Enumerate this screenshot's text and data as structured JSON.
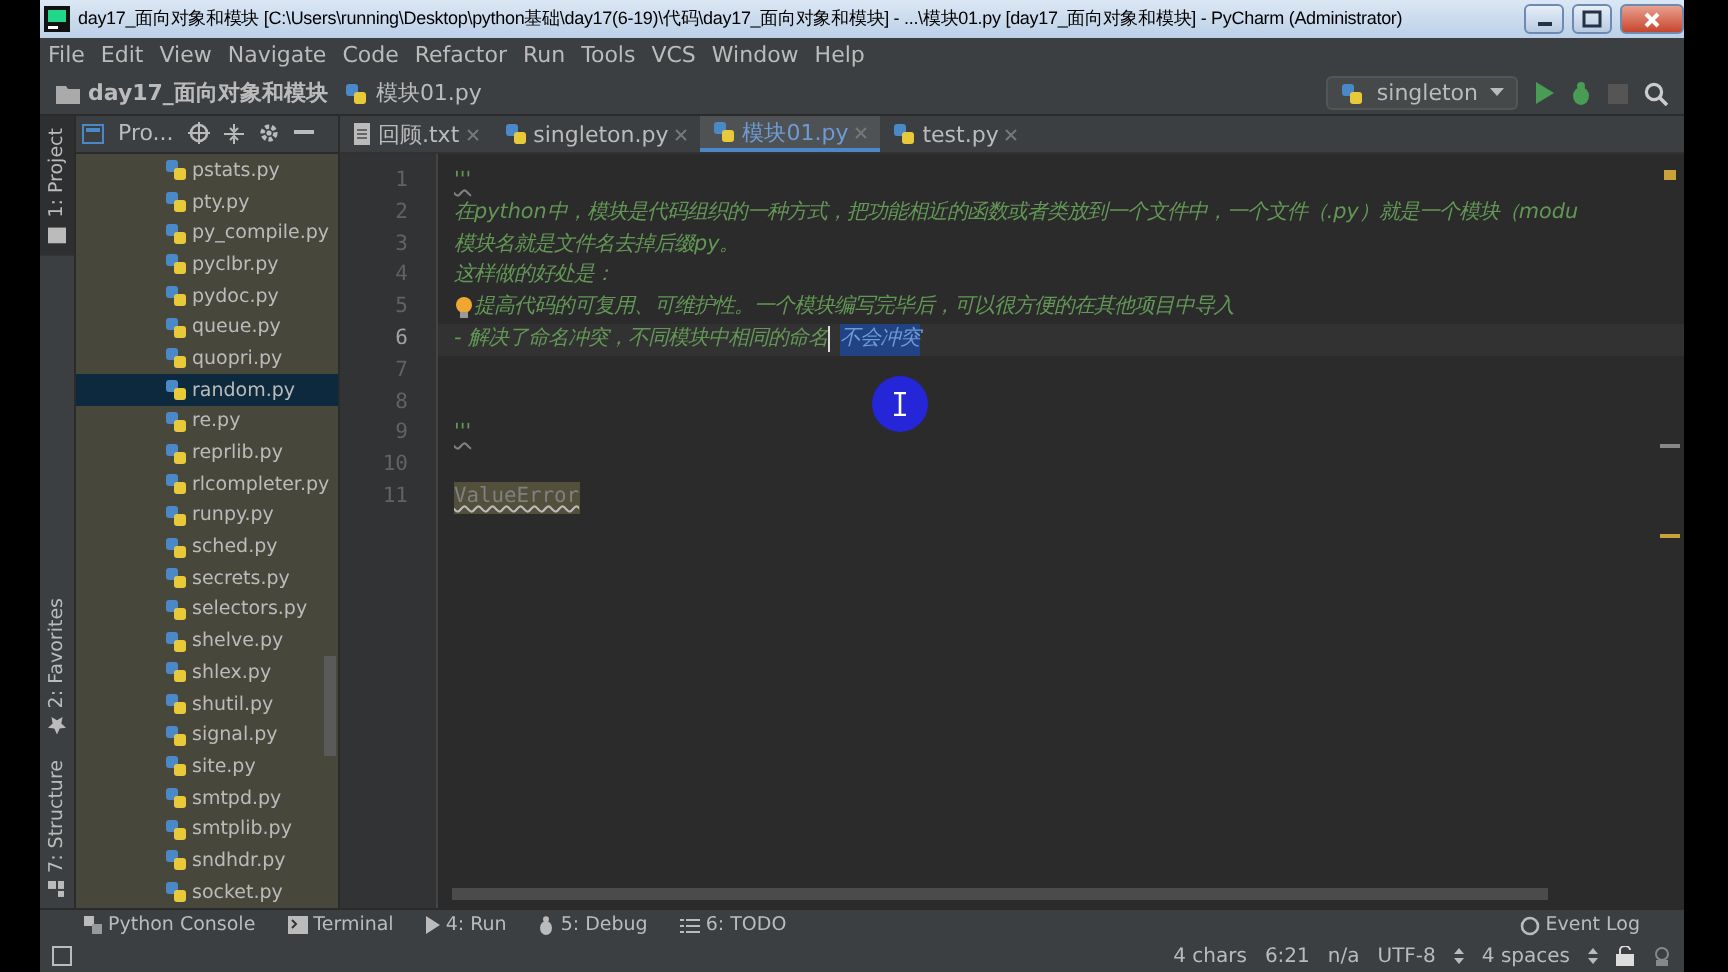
{
  "window": {
    "title": "day17_面向对象和模块 [C:\\Users\\running\\Desktop\\python基础\\day17(6-19)\\代码\\day17_面向对象和模块] - ...\\模块01.py [day17_面向对象和模块] - PyCharm (Administrator)"
  },
  "menu": [
    "File",
    "Edit",
    "View",
    "Navigate",
    "Code",
    "Refactor",
    "Run",
    "Tools",
    "VCS",
    "Window",
    "Help"
  ],
  "navbar": {
    "breadcrumbs": [
      "day17_面向对象和模块",
      "模块01.py"
    ],
    "run_config": "singleton"
  },
  "tool_strip": [
    {
      "label": "1: Project",
      "kind": "project",
      "selected": true
    },
    {
      "label": "2: Favorites",
      "kind": "favorites",
      "selected": false
    },
    {
      "label": "7: Structure",
      "kind": "structure",
      "selected": false
    }
  ],
  "project": {
    "view": "Pro...",
    "files": [
      {
        "name": "pstats.py",
        "selected": false
      },
      {
        "name": "pty.py",
        "selected": false
      },
      {
        "name": "py_compile.py",
        "selected": false
      },
      {
        "name": "pyclbr.py",
        "selected": false
      },
      {
        "name": "pydoc.py",
        "selected": false
      },
      {
        "name": "queue.py",
        "selected": false
      },
      {
        "name": "quopri.py",
        "selected": false
      },
      {
        "name": "random.py",
        "selected": true
      },
      {
        "name": "re.py",
        "selected": false
      },
      {
        "name": "reprlib.py",
        "selected": false
      },
      {
        "name": "rlcompleter.py",
        "selected": false
      },
      {
        "name": "runpy.py",
        "selected": false
      },
      {
        "name": "sched.py",
        "selected": false
      },
      {
        "name": "secrets.py",
        "selected": false
      },
      {
        "name": "selectors.py",
        "selected": false
      },
      {
        "name": "shelve.py",
        "selected": false
      },
      {
        "name": "shlex.py",
        "selected": false
      },
      {
        "name": "shutil.py",
        "selected": false
      },
      {
        "name": "signal.py",
        "selected": false
      },
      {
        "name": "site.py",
        "selected": false
      },
      {
        "name": "smtpd.py",
        "selected": false
      },
      {
        "name": "smtplib.py",
        "selected": false
      },
      {
        "name": "sndhdr.py",
        "selected": false
      },
      {
        "name": "socket.py",
        "selected": false
      }
    ]
  },
  "tabs": [
    {
      "label": "回顾.txt",
      "kind": "text",
      "selected": false
    },
    {
      "label": "singleton.py",
      "kind": "python",
      "selected": false
    },
    {
      "label": "模块01.py",
      "kind": "python",
      "selected": true
    },
    {
      "label": "test.py",
      "kind": "python",
      "selected": false
    }
  ],
  "editor": {
    "lines": [
      {
        "number": "1",
        "kind": "quote",
        "text": "'''",
        "current": false
      },
      {
        "number": "2",
        "kind": "doc",
        "text": "在python中，模块是代码组织的一种方式，把功能相近的函数或者类放到一个文件中，一个文件（.py）就是一个模块（modu",
        "current": false
      },
      {
        "number": "3",
        "kind": "doc",
        "text": "模块名就是文件名去掉后缀py。",
        "current": false
      },
      {
        "number": "4",
        "kind": "doc",
        "text": "这样做的好处是：",
        "current": false
      },
      {
        "number": "5",
        "kind": "hint",
        "text": "提高代码的可复用、可维护性。一个模块编写完毕后，可以很方便的在其他项目中导入",
        "current": false
      },
      {
        "number": "6",
        "kind": "doc",
        "text": "- 解决了命名冲突，不同模块中相同的命名",
        "selection": "不会冲突",
        "current": true
      },
      {
        "number": "7",
        "kind": "doc",
        "current": false
      },
      {
        "number": "8",
        "kind": "doc",
        "current": false
      },
      {
        "number": "9",
        "kind": "quote",
        "text": "'''",
        "current": false
      },
      {
        "number": "10",
        "kind": "doc",
        "current": false
      },
      {
        "number": "11",
        "kind": "warning",
        "text": "ValueError",
        "current": false
      }
    ]
  },
  "bottom_tools": [
    {
      "label": "Python Console",
      "kind": "console"
    },
    {
      "label": "Terminal",
      "kind": "terminal"
    },
    {
      "label": "4: Run",
      "kind": "run"
    },
    {
      "label": "5: Debug",
      "kind": "debug"
    },
    {
      "label": "6: TODO",
      "kind": "todo"
    }
  ],
  "event_log": "Event Log",
  "status": [
    "4 chars",
    "6:21",
    "n/a",
    "UTF-8",
    "4 spaces"
  ]
}
